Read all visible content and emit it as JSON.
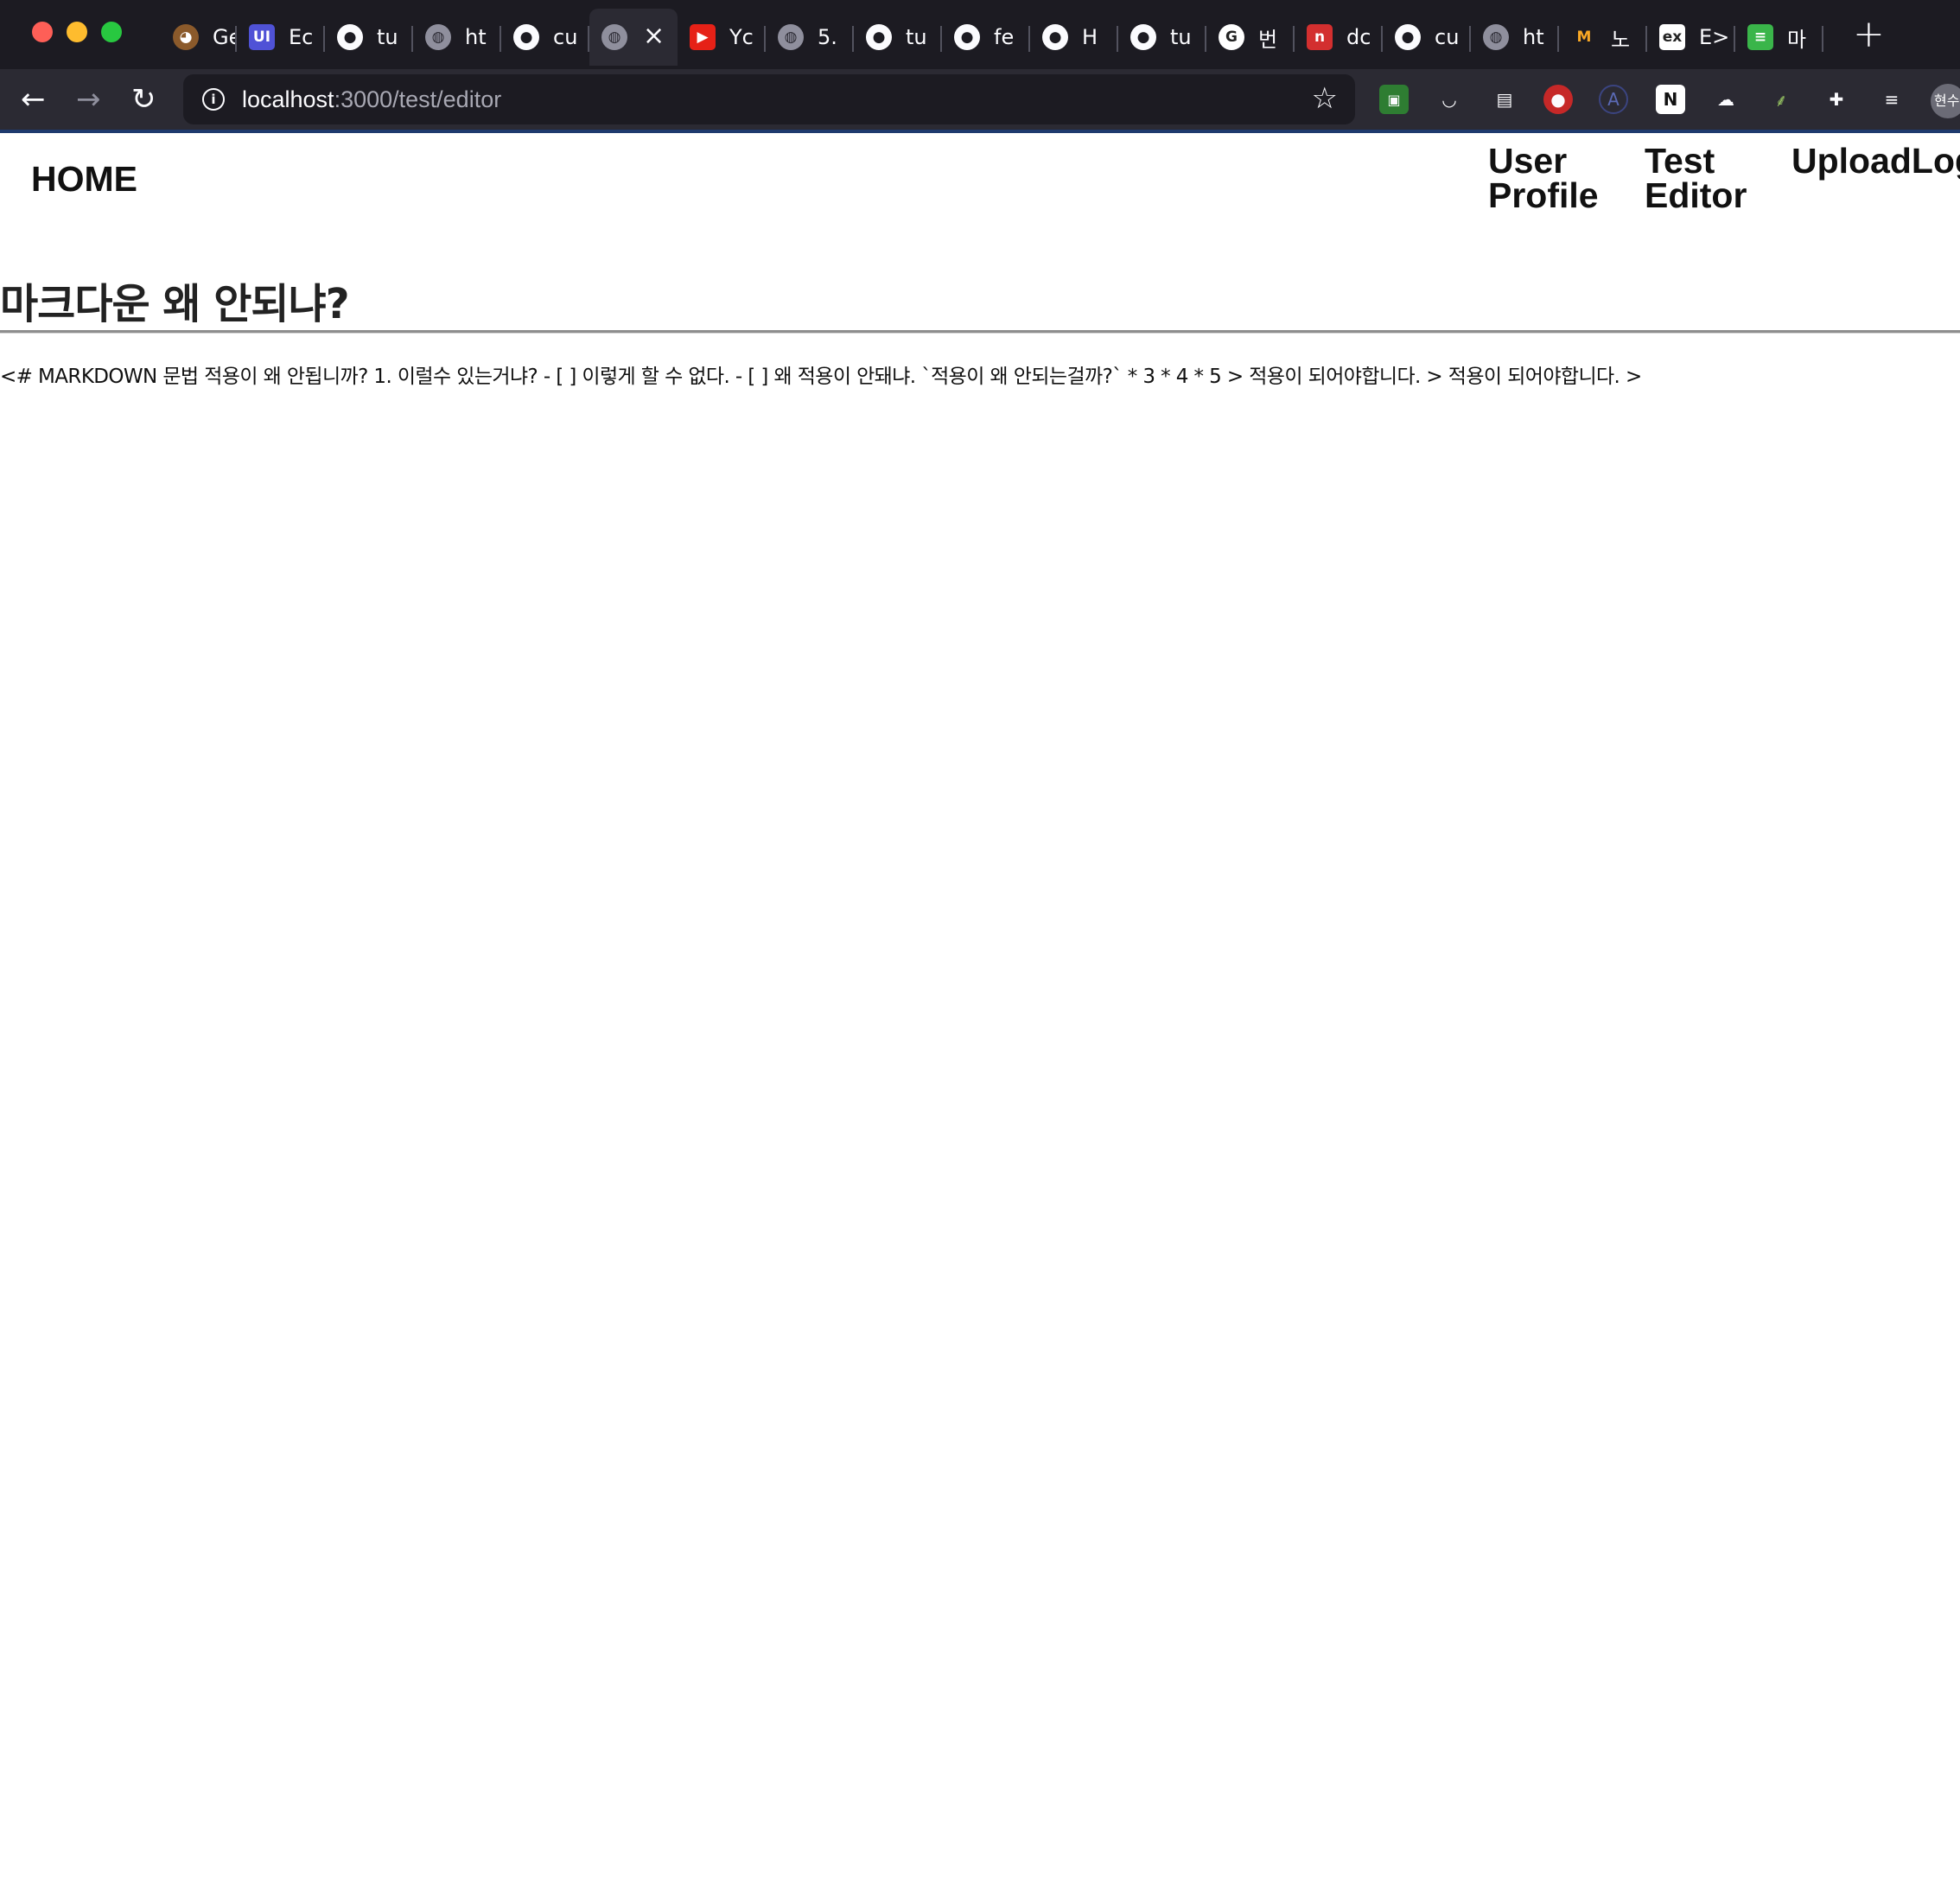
{
  "browser": {
    "tabs": [
      {
        "icon": "pug-icon",
        "title": "Ge",
        "color": "#8b5a2b",
        "glyph": "◕"
      },
      {
        "icon": "ui-icon",
        "title": "Ec",
        "color": "#4f52d6",
        "glyph": "UI"
      },
      {
        "icon": "github-icon",
        "title": "tu",
        "color": "#1c1b22",
        "glyph": "●"
      },
      {
        "icon": "globe-icon",
        "title": "ht",
        "color": "#5b5b66",
        "glyph": "◍"
      },
      {
        "icon": "github-icon",
        "title": "cu",
        "color": "#1c1b22",
        "glyph": "●"
      },
      {
        "icon": "globe-icon",
        "title": "",
        "color": "#5b5b66",
        "glyph": "◍",
        "active": true
      },
      {
        "icon": "youtube-icon",
        "title": "Yc",
        "color": "#e62117",
        "glyph": "▶"
      },
      {
        "icon": "globe-icon",
        "title": "5.",
        "color": "#5b5b66",
        "glyph": "◍"
      },
      {
        "icon": "github-icon",
        "title": "tu",
        "color": "#1c1b22",
        "glyph": "●"
      },
      {
        "icon": "github-icon",
        "title": "fe",
        "color": "#1c1b22",
        "glyph": "●"
      },
      {
        "icon": "github-icon",
        "title": "H",
        "color": "#1c1b22",
        "glyph": "●"
      },
      {
        "icon": "github-icon",
        "title": "tu",
        "color": "#1c1b22",
        "glyph": "●"
      },
      {
        "icon": "google-icon",
        "title": "번",
        "color": "#ffffff",
        "glyph": "G"
      },
      {
        "icon": "notion-red-icon",
        "title": "dc",
        "color": "#d32f2f",
        "glyph": "n"
      },
      {
        "icon": "github-icon",
        "title": "cu",
        "color": "#1c1b22",
        "glyph": "●"
      },
      {
        "icon": "globe-icon",
        "title": "ht",
        "color": "#5b5b66",
        "glyph": "◍"
      },
      {
        "icon": "mcdonalds-icon",
        "title": "노",
        "color": "#1c1b22",
        "glyph": "M"
      },
      {
        "icon": "ex-icon",
        "title": "E>",
        "color": "#ffffff",
        "glyph": "ex"
      },
      {
        "icon": "chat-icon",
        "title": "마",
        "color": "#3ab54a",
        "glyph": "≡"
      }
    ],
    "new_tab": "+",
    "url_host": "localhost",
    "url_path": ":3000/test/editor",
    "avatar_text": "현수"
  },
  "page": {
    "nav": {
      "home": "HOME",
      "user_profile_1": "User",
      "user_profile_2": "Profile",
      "test_editor_1": "Test",
      "test_editor_2": "Editor",
      "upload_logo": "UploadLogo"
    },
    "post": {
      "title": "마크다운 왜 안되냐?",
      "body": "<# MARKDOWN 문법 적용이 왜 안됩니까? 1. 이럴수 있는거냐? - [ ] 이렇게 할 수 없다. - [ ] 왜 적용이 안돼냐. `적용이 왜 안되는걸까?` * 3 * 4 * 5 > 적용이 되어야합니다. > 적용이 되어야합니다. >"
    }
  }
}
